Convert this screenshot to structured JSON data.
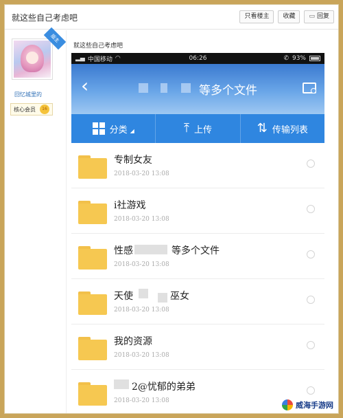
{
  "forum": {
    "thread_title": "就这些自己考虑吧",
    "buttons": {
      "author_only": "只看楼主",
      "favorite": "收藏",
      "reply": "回复"
    },
    "post_title": "就这些自己考虑吧"
  },
  "user": {
    "name": "回忆城里的",
    "member_label": "核心会员",
    "level_badge": "16",
    "vip_ribbon": "版主"
  },
  "phone": {
    "status": {
      "carrier": "中国移动",
      "time": "06:26",
      "battery": "93%"
    },
    "header_title": "等多个文件",
    "toolbar": [
      {
        "label": "分类",
        "icon": "grid-icon"
      },
      {
        "label": "上传",
        "icon": "upload-icon"
      },
      {
        "label": "传输列表",
        "icon": "sort-icon"
      }
    ],
    "files": [
      {
        "name": "专制女友",
        "date": "2018-03-20  13:08"
      },
      {
        "name": "i社游戏",
        "date": "2018-03-20  13:08"
      },
      {
        "name": "性感",
        "name_suffix": "等多个文件",
        "date": "2018-03-20  13:08"
      },
      {
        "name": "天使",
        "name_suffix": "巫女",
        "date": "2018-03-20  13:08"
      },
      {
        "name": "我的资源",
        "date": "2018-03-20  13:08"
      },
      {
        "name": "2@忧郁的弟弟",
        "date": "2018-03-20  13:08"
      }
    ]
  },
  "watermark": {
    "text": "威海手游网"
  },
  "colors": {
    "accent": "#2f86e0",
    "folder": "#f6c851",
    "frame": "#c9a55a"
  }
}
